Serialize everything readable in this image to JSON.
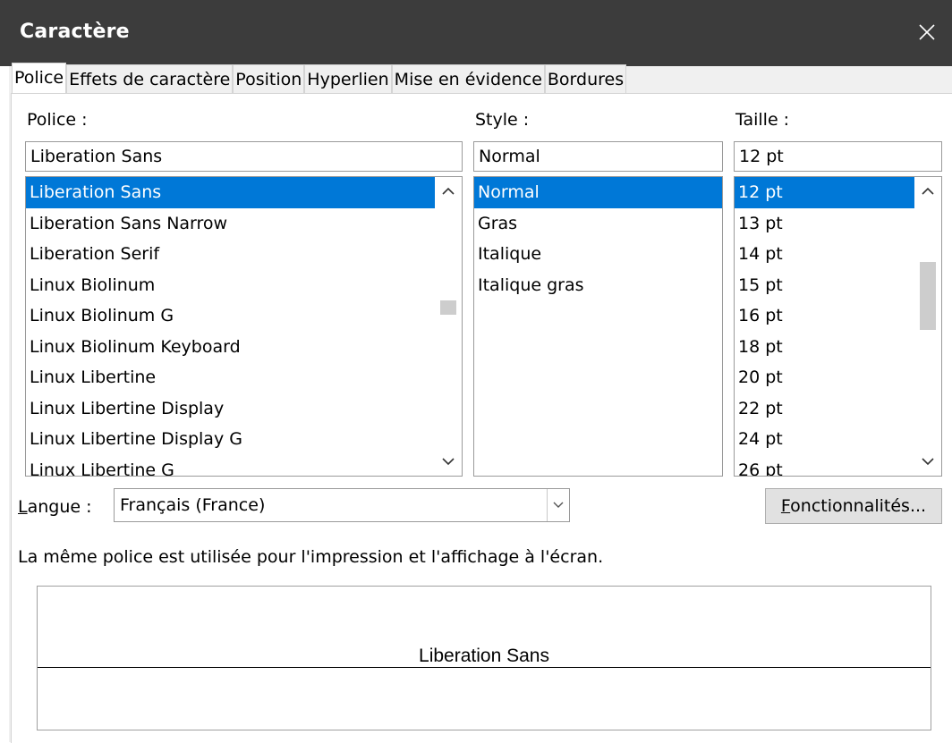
{
  "window": {
    "title": "Caractère"
  },
  "tabs": [
    {
      "label": "Police"
    },
    {
      "label": "Effets de caractère"
    },
    {
      "label": "Position"
    },
    {
      "label": "Hyperlien"
    },
    {
      "label": "Mise en évidence"
    },
    {
      "label": "Bordures"
    }
  ],
  "font": {
    "label": "Police :",
    "value": "Liberation Sans",
    "list": [
      "Liberation Sans",
      "Liberation Sans Narrow",
      "Liberation Serif",
      "Linux Biolinum",
      "Linux Biolinum G",
      "Linux Biolinum Keyboard",
      "Linux Libertine",
      "Linux Libertine Display",
      "Linux Libertine Display G",
      "Linux Libertine G"
    ],
    "selected": "Liberation Sans"
  },
  "style": {
    "label": "Style :",
    "value": "Normal",
    "list": [
      "Normal",
      "Gras",
      "Italique",
      "Italique gras"
    ],
    "selected": "Normal"
  },
  "size": {
    "label": "Taille :",
    "value": "12 pt",
    "list": [
      "12 pt",
      "13 pt",
      "14 pt",
      "15 pt",
      "16 pt",
      "18 pt",
      "20 pt",
      "22 pt",
      "24 pt",
      "26 pt"
    ],
    "selected": "12 pt"
  },
  "language": {
    "label_accel": "L",
    "label_rest": "angue :",
    "value": "Français (France)"
  },
  "features_button": {
    "accel": "F",
    "rest": "onctionnalités..."
  },
  "info_text": "La même police est utilisée pour l'impression et l'affichage à l'écran.",
  "preview": {
    "text": "Liberation Sans"
  },
  "icons": {
    "close": "close-icon",
    "scroll_up": "chevron-up-icon",
    "scroll_down": "chevron-down-icon",
    "dropdown": "chevron-down-icon"
  },
  "colors": {
    "titlebar": "#3c3c3c",
    "selection": "#0078d7",
    "dialog_bg": "#f0f0f0"
  }
}
